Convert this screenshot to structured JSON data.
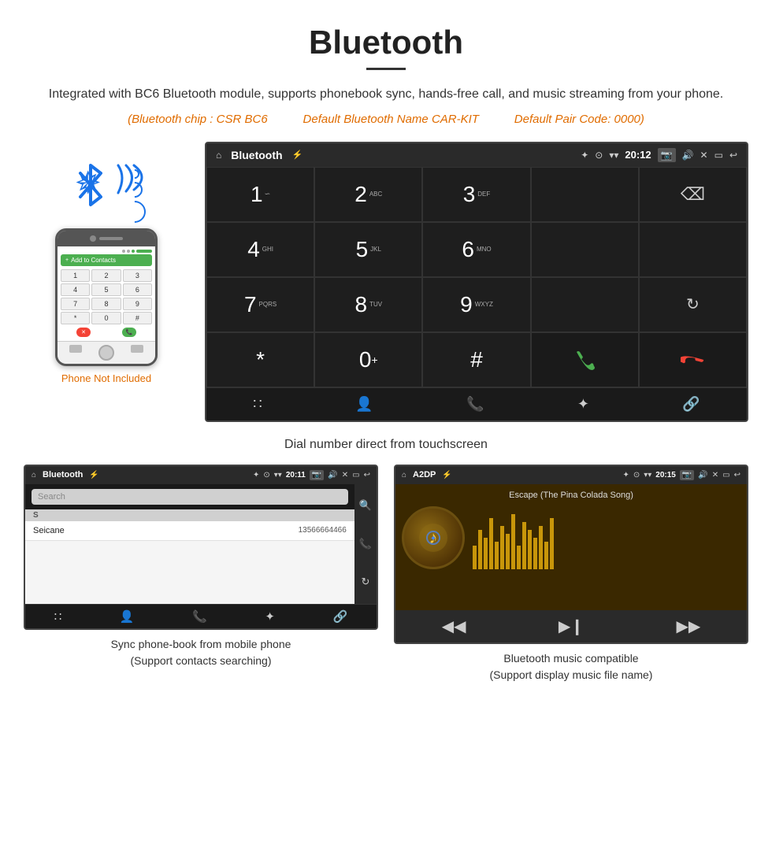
{
  "header": {
    "title": "Bluetooth",
    "description": "Integrated with BC6 Bluetooth module, supports phonebook sync, hands-free call, and music streaming from your phone.",
    "specs": {
      "chip": "(Bluetooth chip : CSR BC6",
      "name": "Default Bluetooth Name CAR-KIT",
      "code": "Default Pair Code: 0000)"
    }
  },
  "phone": {
    "not_included": "Phone Not Included"
  },
  "main_screen": {
    "status_bar": {
      "home": "⌂",
      "title": "Bluetooth",
      "usb": "⚡",
      "bluetooth": "✦",
      "location": "⊙",
      "signal": "▾",
      "time": "20:12",
      "camera": "⬜",
      "volume": "♪",
      "close": "✕",
      "screen": "▭",
      "back": "↩"
    },
    "dialer": {
      "keys": [
        {
          "num": "1",
          "sub": ""
        },
        {
          "num": "2",
          "sub": "ABC"
        },
        {
          "num": "3",
          "sub": "DEF"
        },
        {
          "num": "",
          "sub": ""
        },
        {
          "num": "⌫",
          "sub": ""
        },
        {
          "num": "4",
          "sub": "GHI"
        },
        {
          "num": "5",
          "sub": "JKL"
        },
        {
          "num": "6",
          "sub": "MNO"
        },
        {
          "num": "",
          "sub": ""
        },
        {
          "num": "",
          "sub": ""
        },
        {
          "num": "7",
          "sub": "PQRS"
        },
        {
          "num": "8",
          "sub": "TUV"
        },
        {
          "num": "9",
          "sub": "WXYZ"
        },
        {
          "num": "",
          "sub": ""
        },
        {
          "num": "↻",
          "sub": ""
        },
        {
          "num": "*",
          "sub": ""
        },
        {
          "num": "0",
          "sub": "+"
        },
        {
          "num": "#",
          "sub": ""
        },
        {
          "num": "📞",
          "sub": ""
        },
        {
          "num": "📞",
          "sub": "end"
        }
      ]
    },
    "navbar": [
      "⊞",
      "👤",
      "📞",
      "✦",
      "🔗"
    ]
  },
  "caption_main": "Dial number direct from touchscreen",
  "contacts_screen": {
    "status_bar": {
      "title": "Bluetooth",
      "time": "20:11"
    },
    "search_placeholder": "Search",
    "contacts": [
      {
        "letter": "S",
        "name": "Seicane",
        "phone": "13566664466"
      }
    ],
    "side_icons": [
      "🔍",
      "📞",
      "↻"
    ]
  },
  "music_screen": {
    "status_bar": {
      "title": "A2DP",
      "time": "20:15"
    },
    "song_title": "Escape (The Pina Colada Song)",
    "controls": [
      "⏮",
      "⏯",
      "⏭"
    ]
  },
  "bottom_captions": {
    "left": "Sync phone-book from mobile phone\n(Support contacts searching)",
    "right": "Bluetooth music compatible\n(Support display music file name)"
  }
}
